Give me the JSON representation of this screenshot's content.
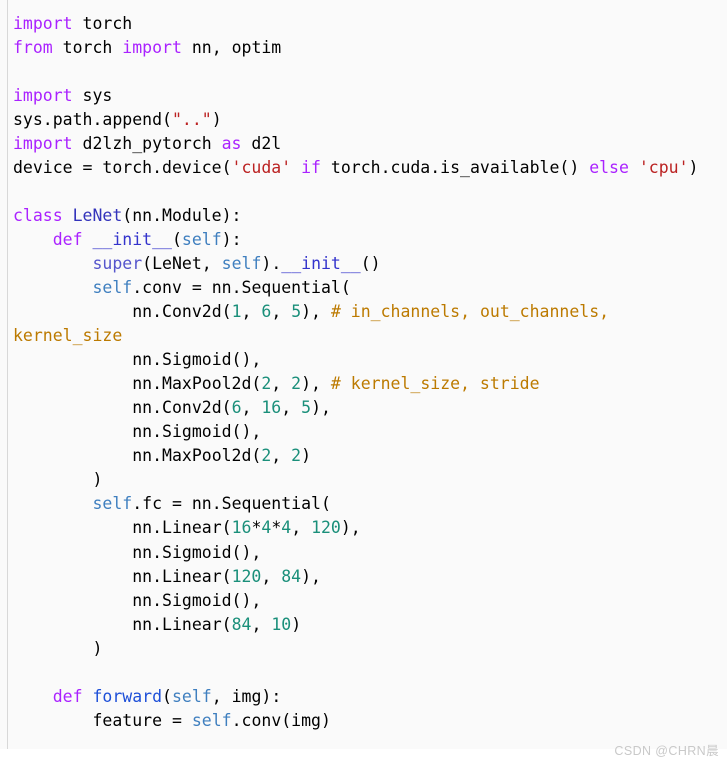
{
  "document": {
    "type": "code-listing",
    "language": "python",
    "background_color": "#fafafa",
    "text_color": "#000000",
    "left_rule_color": "#d8d8d8"
  },
  "syntax_colors": {
    "keyword": "#aa22ff",
    "class_name": "#3333bb",
    "function_name": "#1d4fd8",
    "self": "#3f7fbf",
    "builtin": "#5555cc",
    "magic_method": "#3333cc",
    "string": "#bb2222",
    "number": "#1a8f7a",
    "comment": "#bc7a00",
    "plain": "#000000"
  },
  "code": {
    "lines": [
      [
        {
          "t": "import",
          "c": "k"
        },
        {
          "t": " torch",
          "c": "n"
        }
      ],
      [
        {
          "t": "from",
          "c": "k"
        },
        {
          "t": " torch ",
          "c": "n"
        },
        {
          "t": "import",
          "c": "k"
        },
        {
          "t": " nn, optim",
          "c": "n"
        }
      ],
      [],
      [
        {
          "t": "import",
          "c": "k"
        },
        {
          "t": " sys",
          "c": "n"
        }
      ],
      [
        {
          "t": "sys.path.append(",
          "c": "n"
        },
        {
          "t": "\"..\"",
          "c": "s"
        },
        {
          "t": ")",
          "c": "o"
        }
      ],
      [
        {
          "t": "import",
          "c": "k"
        },
        {
          "t": " d2lzh_pytorch ",
          "c": "n"
        },
        {
          "t": "as",
          "c": "k"
        },
        {
          "t": " d2l",
          "c": "n"
        }
      ],
      [
        {
          "t": "device = torch.device(",
          "c": "n"
        },
        {
          "t": "'cuda'",
          "c": "s"
        },
        {
          "t": " ",
          "c": "n"
        },
        {
          "t": "if",
          "c": "k"
        },
        {
          "t": " torch.cuda.is_available() ",
          "c": "n"
        },
        {
          "t": "else",
          "c": "k"
        },
        {
          "t": " ",
          "c": "n"
        },
        {
          "t": "'cpu'",
          "c": "s"
        },
        {
          "t": ")",
          "c": "o"
        }
      ],
      [],
      [
        {
          "t": "class",
          "c": "k"
        },
        {
          "t": " ",
          "c": "n"
        },
        {
          "t": "LeNet",
          "c": "nc"
        },
        {
          "t": "(nn.Module):",
          "c": "n"
        }
      ],
      [
        {
          "t": "    ",
          "c": "n"
        },
        {
          "t": "def",
          "c": "k"
        },
        {
          "t": " ",
          "c": "n"
        },
        {
          "t": "__init__",
          "c": "fm"
        },
        {
          "t": "(",
          "c": "o"
        },
        {
          "t": "self",
          "c": "bp"
        },
        {
          "t": "):",
          "c": "o"
        }
      ],
      [
        {
          "t": "        ",
          "c": "n"
        },
        {
          "t": "super",
          "c": "nb"
        },
        {
          "t": "(LeNet, ",
          "c": "n"
        },
        {
          "t": "self",
          "c": "bp"
        },
        {
          "t": ").",
          "c": "o"
        },
        {
          "t": "__init__",
          "c": "fm"
        },
        {
          "t": "()",
          "c": "o"
        }
      ],
      [
        {
          "t": "        ",
          "c": "n"
        },
        {
          "t": "self",
          "c": "bp"
        },
        {
          "t": ".conv = nn.Sequential(",
          "c": "n"
        }
      ],
      [
        {
          "t": "            nn.Conv2d(",
          "c": "n"
        },
        {
          "t": "1",
          "c": "m"
        },
        {
          "t": ", ",
          "c": "o"
        },
        {
          "t": "6",
          "c": "m"
        },
        {
          "t": ", ",
          "c": "o"
        },
        {
          "t": "5",
          "c": "m"
        },
        {
          "t": "), ",
          "c": "o"
        },
        {
          "t": "# in_channels, out_channels, kernel_size",
          "c": "c"
        }
      ],
      [
        {
          "t": "            nn.Sigmoid(),",
          "c": "n"
        }
      ],
      [
        {
          "t": "            nn.MaxPool2d(",
          "c": "n"
        },
        {
          "t": "2",
          "c": "m"
        },
        {
          "t": ", ",
          "c": "o"
        },
        {
          "t": "2",
          "c": "m"
        },
        {
          "t": "), ",
          "c": "o"
        },
        {
          "t": "# kernel_size, stride",
          "c": "c"
        }
      ],
      [
        {
          "t": "            nn.Conv2d(",
          "c": "n"
        },
        {
          "t": "6",
          "c": "m"
        },
        {
          "t": ", ",
          "c": "o"
        },
        {
          "t": "16",
          "c": "m"
        },
        {
          "t": ", ",
          "c": "o"
        },
        {
          "t": "5",
          "c": "m"
        },
        {
          "t": "),",
          "c": "o"
        }
      ],
      [
        {
          "t": "            nn.Sigmoid(),",
          "c": "n"
        }
      ],
      [
        {
          "t": "            nn.MaxPool2d(",
          "c": "n"
        },
        {
          "t": "2",
          "c": "m"
        },
        {
          "t": ", ",
          "c": "o"
        },
        {
          "t": "2",
          "c": "m"
        },
        {
          "t": ")",
          "c": "o"
        }
      ],
      [
        {
          "t": "        )",
          "c": "o"
        }
      ],
      [
        {
          "t": "        ",
          "c": "n"
        },
        {
          "t": "self",
          "c": "bp"
        },
        {
          "t": ".fc = nn.Sequential(",
          "c": "n"
        }
      ],
      [
        {
          "t": "            nn.Linear(",
          "c": "n"
        },
        {
          "t": "16",
          "c": "m"
        },
        {
          "t": "*",
          "c": "o"
        },
        {
          "t": "4",
          "c": "m"
        },
        {
          "t": "*",
          "c": "o"
        },
        {
          "t": "4",
          "c": "m"
        },
        {
          "t": ", ",
          "c": "o"
        },
        {
          "t": "120",
          "c": "m"
        },
        {
          "t": "),",
          "c": "o"
        }
      ],
      [
        {
          "t": "            nn.Sigmoid(),",
          "c": "n"
        }
      ],
      [
        {
          "t": "            nn.Linear(",
          "c": "n"
        },
        {
          "t": "120",
          "c": "m"
        },
        {
          "t": ", ",
          "c": "o"
        },
        {
          "t": "84",
          "c": "m"
        },
        {
          "t": "),",
          "c": "o"
        }
      ],
      [
        {
          "t": "            nn.Sigmoid(),",
          "c": "n"
        }
      ],
      [
        {
          "t": "            nn.Linear(",
          "c": "n"
        },
        {
          "t": "84",
          "c": "m"
        },
        {
          "t": ", ",
          "c": "o"
        },
        {
          "t": "10",
          "c": "m"
        },
        {
          "t": ")",
          "c": "o"
        }
      ],
      [
        {
          "t": "        )",
          "c": "o"
        }
      ],
      [],
      [
        {
          "t": "    ",
          "c": "n"
        },
        {
          "t": "def",
          "c": "k"
        },
        {
          "t": " ",
          "c": "n"
        },
        {
          "t": "forward",
          "c": "nf"
        },
        {
          "t": "(",
          "c": "o"
        },
        {
          "t": "self",
          "c": "bp"
        },
        {
          "t": ", img):",
          "c": "o"
        }
      ],
      [
        {
          "t": "        feature = ",
          "c": "n"
        },
        {
          "t": "self",
          "c": "bp"
        },
        {
          "t": ".conv(img)",
          "c": "n"
        }
      ]
    ]
  },
  "watermark": {
    "text": "CSDN @CHRN晨"
  }
}
